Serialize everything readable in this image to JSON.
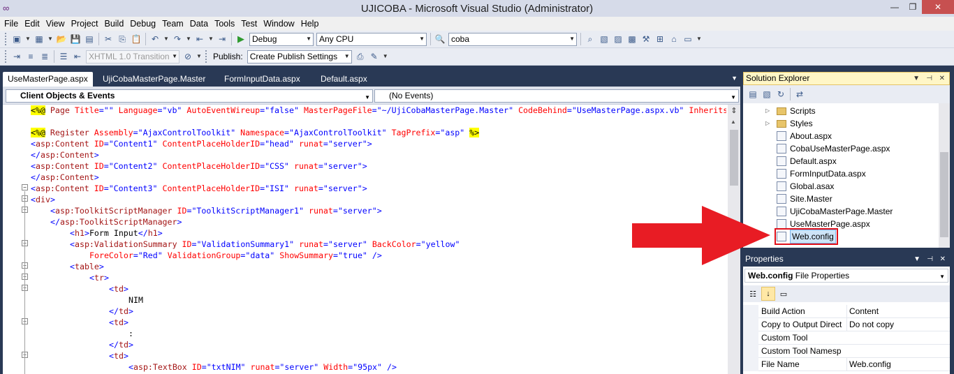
{
  "window": {
    "title": "UJICOBA - Microsoft Visual Studio (Administrator)"
  },
  "menu": [
    "File",
    "Edit",
    "View",
    "Project",
    "Build",
    "Debug",
    "Team",
    "Data",
    "Tools",
    "Test",
    "Window",
    "Help"
  ],
  "toolbar1": {
    "config": "Debug",
    "platform": "Any CPU",
    "find": "coba"
  },
  "toolbar2": {
    "schema": "XHTML 1.0 Transition",
    "publish_label": "Publish:",
    "publish_value": "Create Publish Settings"
  },
  "doc_tabs": [
    "UseMasterPage.aspx",
    "UjiCobaMasterPage.Master",
    "FormInputData.aspx",
    "Default.aspx"
  ],
  "editor": {
    "objects": "Client Objects & Events",
    "events": "(No Events)",
    "line1": {
      "d1": "<%@",
      "tag": " Page ",
      "a1": "Title",
      "v1": "=\"\" ",
      "a2": "Language",
      "v2": "=\"vb\" ",
      "a3": "AutoEventWireup",
      "v3": "=\"false\" ",
      "a4": "MasterPageFile",
      "v4": "=\"~/UjiCobaMasterPage.Master\" ",
      "a5": "CodeBehind",
      "v5": "=\"UseMasterPage.aspx.vb\" ",
      "a6": "Inherits"
    },
    "line2": {
      "d1": "<%@",
      "tag": " Register ",
      "a1": "Assembly",
      "v1": "=\"AjaxControlToolkit\" ",
      "a2": "Namespace",
      "v2": "=\"AjaxControlToolkit\" ",
      "a3": "TagPrefix",
      "v3": "=\"asp\" ",
      "d2": "%>"
    },
    "c1": {
      "o": "<",
      "tag": "asp:Content",
      "a1": " ID",
      "v1": "=\"Content1\"",
      "a2": " ContentPlaceHolderID",
      "v2": "=\"head\"",
      "a3": " runat",
      "v3": "=\"server\"",
      "c": ">"
    },
    "c1_close": {
      "o": "</",
      "tag": "asp:Content",
      "c": ">"
    },
    "c2": {
      "o": "<",
      "tag": "asp:Content",
      "a1": " ID",
      "v1": "=\"Content2\"",
      "a2": " ContentPlaceHolderID",
      "v2": "=\"CSS\"",
      "a3": " runat",
      "v3": "=\"server\"",
      "c": ">"
    },
    "c2_close": {
      "o": "</",
      "tag": "asp:Content",
      "c": ">"
    },
    "c3": {
      "o": "<",
      "tag": "asp:Content",
      "a1": " ID",
      "v1": "=\"Content3\"",
      "a2": " ContentPlaceHolderID",
      "v2": "=\"ISI\"",
      "a3": " runat",
      "v3": "=\"server\"",
      "c": ">"
    },
    "div": {
      "o": "<",
      "tag": "div",
      "c": ">"
    },
    "tsm": {
      "o": "<",
      "tag": "asp:ToolkitScriptManager",
      "a1": " ID",
      "v1": "=\"ToolkitScriptManager1\"",
      "a2": " runat",
      "v2": "=\"server\"",
      "c": ">"
    },
    "tsm_close": {
      "o": "</",
      "tag": "asp:ToolkitScriptManager",
      "c": ">"
    },
    "h1": {
      "o": "<",
      "tag": "h1",
      "c": ">",
      "text": "Form Input",
      "o2": "</",
      "tag2": "h1",
      "c2": ">"
    },
    "vs": {
      "o": "<",
      "tag": "asp:ValidationSummary",
      "a1": " ID",
      "v1": "=\"ValidationSummary1\"",
      "a2": " runat",
      "v2": "=\"server\"",
      "a3": " BackColor",
      "v3": "=\"yellow\""
    },
    "vs2": {
      "a1": "ForeColor",
      "v1": "=\"Red\"",
      "a2": " ValidationGroup",
      "v2": "=\"data\"",
      "a3": " ShowSummary",
      "v3": "=\"true\"",
      "c": " />"
    },
    "table": {
      "o": "<",
      "tag": "table",
      "c": ">"
    },
    "tr": {
      "o": "<",
      "tag": "tr",
      "c": ">"
    },
    "td1": {
      "o": "<",
      "tag": "td",
      "c": ">"
    },
    "nim": "NIM",
    "td1_close": {
      "o": "</",
      "tag": "td",
      "c": ">"
    },
    "td2": {
      "o": "<",
      "tag": "td",
      "c": ">"
    },
    "colon": ":",
    "td2_close": {
      "o": "</",
      "tag": "td",
      "c": ">"
    },
    "td3": {
      "o": "<",
      "tag": "td",
      "c": ">"
    },
    "tb": {
      "o": "<",
      "tag": "asp:TextBox",
      "a1": " ID",
      "v1": "=\"txtNIM\"",
      "a2": " runat",
      "v2": "=\"server\"",
      "a3": " Width",
      "v3": "=\"95px\"",
      "c": " />"
    }
  },
  "solution_explorer": {
    "title": "Solution Explorer",
    "items": [
      "Scripts",
      "Styles",
      "About.aspx",
      "CobaUseMasterPage.aspx",
      "Default.aspx",
      "FormInputData.aspx",
      "Global.asax",
      "Site.Master",
      "UjiCobaMasterPage.Master",
      "UseMasterPage.aspx",
      "Web.config"
    ]
  },
  "properties": {
    "title": "Properties",
    "object_name": "Web.config",
    "object_type": "File Properties",
    "rows": [
      {
        "name": "Build Action",
        "value": "Content"
      },
      {
        "name": "Copy to Output Direct",
        "value": "Do not copy"
      },
      {
        "name": "Custom Tool",
        "value": ""
      },
      {
        "name": "Custom Tool Namesp",
        "value": ""
      },
      {
        "name": "File Name",
        "value": "Web.config"
      }
    ]
  },
  "colors": {
    "annotation_arrow": "#e81c24",
    "vs_chrome": "#293955",
    "tag": "#a31515",
    "attr": "#ff0000",
    "value": "#0000ff"
  }
}
